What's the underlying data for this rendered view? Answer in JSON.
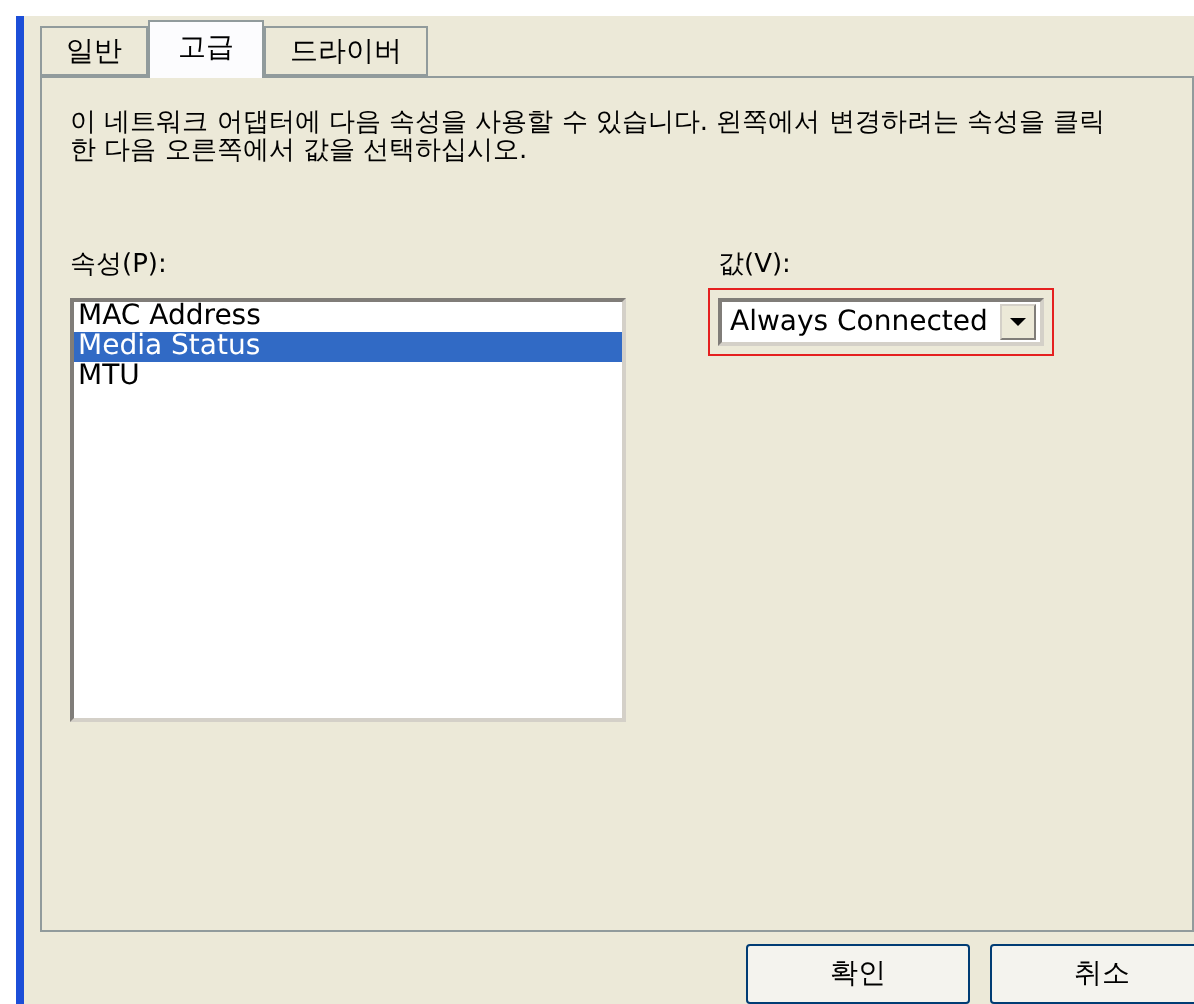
{
  "tabs": [
    {
      "label": "일반",
      "selected": false
    },
    {
      "label": "고급",
      "selected": true
    },
    {
      "label": "드라이버",
      "selected": false
    }
  ],
  "description": "이 네트워크 어댑터에 다음 속성을 사용할 수 있습니다. 왼쪽에서 변경하려는 속성을 클릭한 다음 오른쪽에서 값을 선택하십시오.",
  "property_label": "속성(P):",
  "properties": [
    {
      "label": "MAC Address",
      "selected": false
    },
    {
      "label": "Media Status",
      "selected": true
    },
    {
      "label": "MTU",
      "selected": false
    }
  ],
  "value_label": "값(V):",
  "value_dropdown": {
    "value": "Always Connected",
    "highlighted": true
  },
  "buttons": [
    "확인",
    "취소"
  ]
}
